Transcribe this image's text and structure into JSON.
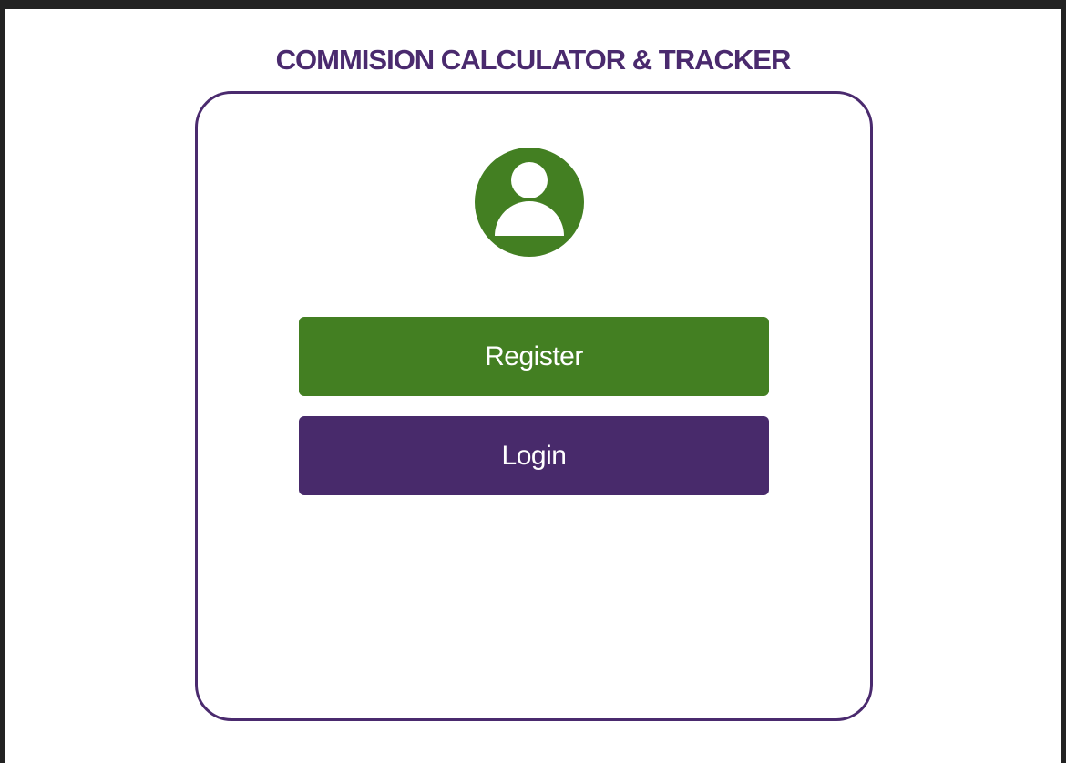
{
  "app": {
    "title": "COMMISION CALCULATOR & TRACKER"
  },
  "card": {
    "avatar_icon": "user-icon",
    "register_label": "Register",
    "login_label": "Login"
  },
  "colors": {
    "brand_purple": "#482a6b",
    "brand_green": "#437f22",
    "background": "#ffffff",
    "frame": "#222222"
  }
}
